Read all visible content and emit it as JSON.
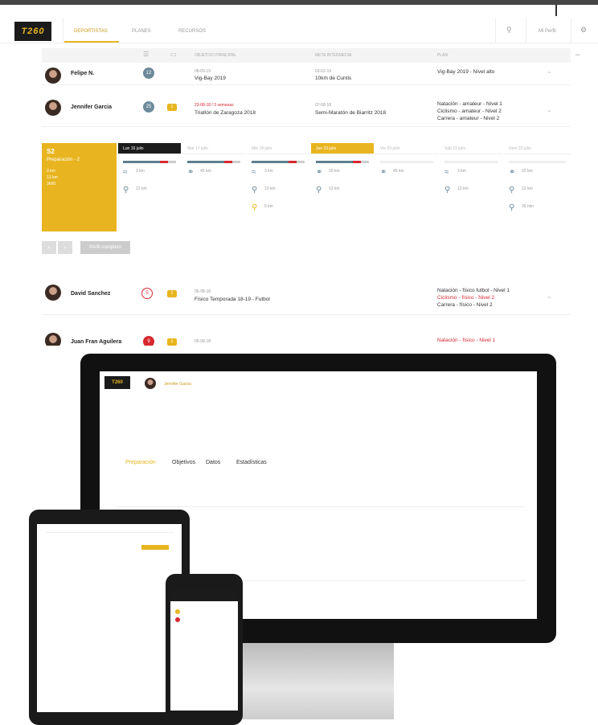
{
  "nav": {
    "logo": "T260",
    "tabs": [
      "DEPORTISTAS",
      "PLANES",
      "RECURSOS"
    ],
    "profile": "Mi Perfil"
  },
  "header": {
    "cols": [
      "OBJETIVO PRINCIPAL",
      "META INTERMEDIA",
      "PLAN"
    ]
  },
  "rows": [
    {
      "name": "Felipe N.",
      "badge": "12",
      "obj_date": "08-09-19",
      "obj": "Vig-Bay 2019",
      "meta_date": "03-02-19",
      "meta": "10km de Cuntis",
      "plan": [
        "Vig-Bay 2019 - Nivel alto"
      ]
    },
    {
      "name": "Jennifer Garcia",
      "badge": "25",
      "note": "1",
      "obj_date": "23-08-18 / 3 semanas",
      "obj": "Triatlón de Zaragoza 2018",
      "meta_date": "07-08-18",
      "meta": "Semi-Maratón de Biarritz 2018",
      "plan": [
        "Natación - amateur - Nivel 1",
        "Ciclismo - amateur - Nivel 2",
        "Carrera - amateur - Nivel 2"
      ]
    },
    {
      "name": "David Sanchez",
      "badge": "5",
      "note": "1",
      "obj_date": "05-08-18",
      "obj": "Físico Temporada 18-19 - Futbol",
      "plan": [
        "Natación - físico futbol - Nivel 1",
        "Ciclismo - físico - Nivel 2",
        "Carrera - físico - Nivel 2"
      ]
    },
    {
      "name": "Juan Fran Aguilera",
      "badge": "9",
      "note": "1",
      "obj_date": "05-08-18",
      "plan": [
        "Natación - físico - Nivel 1"
      ]
    }
  ],
  "week": {
    "label": "S2",
    "phase": "Preparación - 2",
    "days": [
      "Lun 16 julio",
      "Mar 17 julio",
      "Mié 18 julio",
      "Jue 19 julio",
      "Vie 20 julio",
      "Sab 21 julio",
      "Dom 22 julio"
    ],
    "stats": [
      "3 km",
      "13 km",
      "3h00"
    ]
  },
  "activities": [
    "3 km",
    "13 km",
    "45 km",
    "3 km",
    "13 km",
    "5 km",
    "20 km",
    "13 km",
    "45 km",
    "3 km",
    "13 km",
    "20 km",
    "13 km",
    "30 min"
  ],
  "buttons": {
    "perfil": "Perfil completo"
  },
  "mock": {
    "user": "Jennifer Garcia",
    "tabs": [
      "Preparación",
      "Objetivos",
      "Datos",
      "Estadísticas"
    ]
  }
}
